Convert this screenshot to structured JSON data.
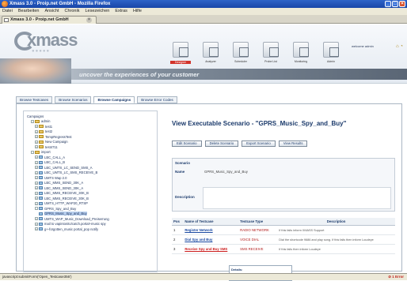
{
  "window": {
    "title": "Xmass 3.0 - Proip.net GmbH - Mozilla Firefox"
  },
  "menu": [
    "Datei",
    "Bearbeiten",
    "Ansicht",
    "Chronik",
    "Lesezeichen",
    "Extras",
    "Hilfe"
  ],
  "browser_tab": {
    "label": "Xmass 3.0 - Proip.net GmbH"
  },
  "header": {
    "logo": "xmass",
    "tagline": "uncover the experiences of your customer",
    "tools": [
      {
        "label": "Designer",
        "active": true
      },
      {
        "label": "Analyzer",
        "active": false
      },
      {
        "label": "Scheduler",
        "active": false
      },
      {
        "label": "Probe List",
        "active": false
      },
      {
        "label": "Monitoring",
        "active": false
      },
      {
        "label": "Admin",
        "active": false
      }
    ],
    "user": "welcome admin"
  },
  "nav_tabs": [
    {
      "label": "Browse Testcases",
      "active": false
    },
    {
      "label": "Browse Scenarios",
      "active": false
    },
    {
      "label": "Browse Campaigns",
      "active": true
    },
    {
      "label": "Browse Error Codes",
      "active": false
    }
  ],
  "tree": {
    "root": "Campaigns",
    "rows": [
      {
        "label": "admin",
        "kind": "folder",
        "level": 1,
        "expander": "-"
      },
      {
        "label": "test1",
        "kind": "folder",
        "level": 2,
        "expander": "+"
      },
      {
        "label": "test2",
        "kind": "folder",
        "level": 2,
        "expander": "+"
      },
      {
        "label": "TempRegressTest",
        "kind": "folder",
        "level": 2,
        "expander": "+"
      },
      {
        "label": "New Campaign",
        "kind": "folder",
        "level": 2,
        "expander": "+"
      },
      {
        "label": "test4711",
        "kind": "folder",
        "level": 2,
        "expander": "+"
      },
      {
        "label": "import",
        "kind": "folder",
        "level": 1,
        "expander": "-"
      },
      {
        "label": "LBC_CALL_A",
        "kind": "scenario",
        "level": 2,
        "expander": "+"
      },
      {
        "label": "LBC_CALL_B",
        "kind": "scenario",
        "level": 2,
        "expander": "+"
      },
      {
        "label": "LBC_UMTS_LC_SEND_SMS_A",
        "kind": "scenario",
        "level": 2,
        "expander": "+"
      },
      {
        "label": "LBC_UMTS_LC_SMS_RECEIVE_B",
        "kind": "scenario",
        "level": 2,
        "expander": "+"
      },
      {
        "label": "UMTS Wap 2.0",
        "kind": "scenario",
        "level": 2,
        "expander": "+"
      },
      {
        "label": "LBC_MMS_SEND_30K_A",
        "kind": "scenario",
        "level": 2,
        "expander": "+"
      },
      {
        "label": "LBC_MMS_SEND_30K_A",
        "kind": "scenario",
        "level": 2,
        "expander": "+"
      },
      {
        "label": "LBC_MMS_RECEIVE_30K_B",
        "kind": "scenario",
        "level": 2,
        "expander": "+"
      },
      {
        "label": "LBC_MMS_RECEIVE_30K_B",
        "kind": "scenario",
        "level": 2,
        "expander": "+"
      },
      {
        "label": "UMTS_HTTP_WAP20_RTSP",
        "kind": "scenario",
        "level": 2,
        "expander": "+"
      },
      {
        "label": "GPRS_Spy_and_Buy",
        "kind": "scenario",
        "level": 2,
        "expander": "-"
      },
      {
        "label": "GPRS_Music_Spy_and_Buy",
        "kind": "scenario",
        "level": 3,
        "expander": "",
        "selected": true
      },
      {
        "label": "UMTS_WAP_Music_Download_Preiserrung",
        "kind": "scenario",
        "level": 2,
        "expander": "+"
      },
      {
        "label": "mail to vapintonito/catch.portal+music spy",
        "kind": "scenario",
        "level": 2,
        "expander": "+"
      },
      {
        "label": "g+-forgotten_music portal_pop notify",
        "kind": "scenario",
        "level": 2,
        "expander": "+"
      }
    ]
  },
  "scenario": {
    "heading": "View Executable Scenario - \"GPRS_Music_Spy_and_Buy\"",
    "buttons": [
      "Edit Scenario",
      "Delete Scenario",
      "Export Scenario",
      "View Results"
    ],
    "section_label": "Scenario",
    "name_label": "Name",
    "name_value": "GPRS_Music_Spy_and_Buy",
    "description_label": "Description"
  },
  "testcases": {
    "headers": [
      "Pos",
      "Name of Testcase",
      "Testcase Type",
      "Description"
    ],
    "rows": [
      {
        "pos": "1",
        "name": "Register Network",
        "type": "RADIO NETWORK",
        "desc": "If this fails inform XMASS Support",
        "error": false
      },
      {
        "pos": "2",
        "name": "Dial Spy and Buy",
        "type": "VOICE DIAL",
        "desc": "Dial the shortcode 9686 and play song. If this fails then inform Loudeye",
        "error": false
      },
      {
        "pos": "3",
        "name": "Receive Spy and Buy SMS",
        "type": "SMS RECEIVE",
        "desc": "If this fails then inform Loudeye",
        "error": true
      }
    ]
  },
  "details_popup": {
    "title": "Details:",
    "text": "If this fails then inform Loudeye"
  },
  "status": {
    "text": "javascript:submitForm('Open_Testcase356')",
    "error": "1 Error"
  },
  "colors": {
    "titlebar": "#1846a8",
    "accent_red": "#cc1d1d",
    "link_blue": "#1b4aa2"
  }
}
